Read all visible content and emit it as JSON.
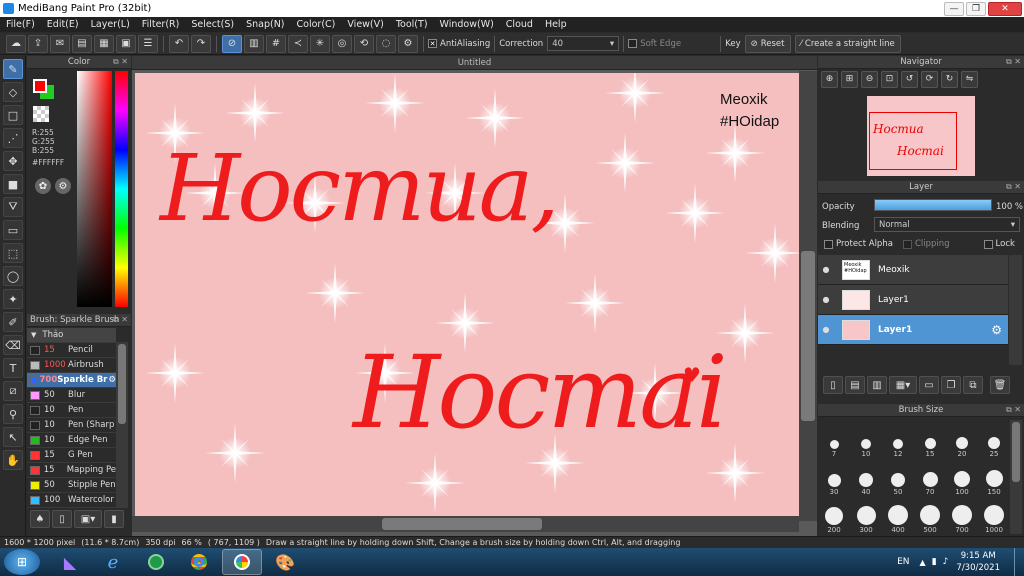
{
  "window": {
    "title": "MediBang Paint Pro (32bit)"
  },
  "menu": [
    "File(F)",
    "Edit(E)",
    "Layer(L)",
    "Filter(R)",
    "Select(S)",
    "Snap(N)",
    "Color(C)",
    "View(V)",
    "Tool(T)",
    "Window(W)",
    "Cloud",
    "Help"
  ],
  "toolbar": {
    "antialiasing_label": "AntiAliasing",
    "correction_label": "Correction",
    "correction_value": "40",
    "soft_edge_label": "Soft Edge",
    "key_label": "Key",
    "reset_label": "Reset",
    "straight_line_label": "Create a straight line"
  },
  "color_panel": {
    "title": "Color",
    "r": "R:255",
    "g": "G:255",
    "b": "B:255",
    "hex": "#FFFFFF",
    "primary_color": "#ff0000",
    "secondary_color": "#22cc22"
  },
  "brush_panel": {
    "title": "Brush: Sparkle Brush",
    "group": "Thảo",
    "items": [
      {
        "size": "15",
        "name": "Pencil",
        "color": "#222222"
      },
      {
        "size": "1000",
        "name": "Airbrush",
        "color": "#bbbbbb"
      },
      {
        "size": "700",
        "name": "Sparkle Br",
        "color": "#3366ff"
      },
      {
        "size": "50",
        "name": "Blur",
        "color": "#ff99ff"
      },
      {
        "size": "10",
        "name": "Pen",
        "color": "#222222"
      },
      {
        "size": "10",
        "name": "Pen (Sharp",
        "color": "#222222"
      },
      {
        "size": "10",
        "name": "Edge Pen",
        "color": "#22bb22"
      },
      {
        "size": "15",
        "name": "G Pen",
        "color": "#ff3333"
      },
      {
        "size": "15",
        "name": "Mapping Pe",
        "color": "#ff3333"
      },
      {
        "size": "50",
        "name": "Stipple Pen",
        "color": "#eeee00"
      },
      {
        "size": "100",
        "name": "Watercolor",
        "color": "#33bbff"
      }
    ]
  },
  "document": {
    "tab_title": "Untitled"
  },
  "canvas": {
    "line1": "Hocmua,",
    "line2": "Hocmai",
    "corner_line1": "Meoxik",
    "corner_line2": "#HOidap"
  },
  "navigator": {
    "title": "Navigator",
    "thumb_line1": "Hocmua",
    "thumb_line2": "Hocmai"
  },
  "layer_panel": {
    "title": "Layer",
    "opacity_label": "Opacity",
    "opacity_value": "100 %",
    "opacity_fraction": 1.0,
    "blending_label": "Blending",
    "blending_value": "Normal",
    "protect_alpha": "Protect Alpha",
    "clipping": "Clipping",
    "lock": "Lock",
    "layers": [
      {
        "name": "Meoxik",
        "thumb_text": "Meoxik #HOidap",
        "selected": false
      },
      {
        "name": "Layer1",
        "thumb_text": "",
        "selected": false
      },
      {
        "name": "Layer1",
        "thumb_text": "",
        "selected": true
      }
    ]
  },
  "brush_size": {
    "title": "Brush Size",
    "sizes": [
      "7",
      "10",
      "12",
      "15",
      "20",
      "25",
      "30",
      "40",
      "50",
      "70",
      "100",
      "150",
      "200",
      "300",
      "400",
      "500",
      "700",
      "1000"
    ]
  },
  "status": {
    "size": "1600 * 1200 pixel",
    "physical": "(11.6 * 8.7cm)",
    "dpi": "350 dpi",
    "zoom": "66 %",
    "coords": "( 767, 1109 )",
    "hint": "Draw a straight line by holding down Shift, Change a brush size by holding down Ctrl, Alt, and dragging"
  },
  "taskbar": {
    "lang": "EN",
    "time": "9:15 AM",
    "date": "7/30/2021"
  }
}
